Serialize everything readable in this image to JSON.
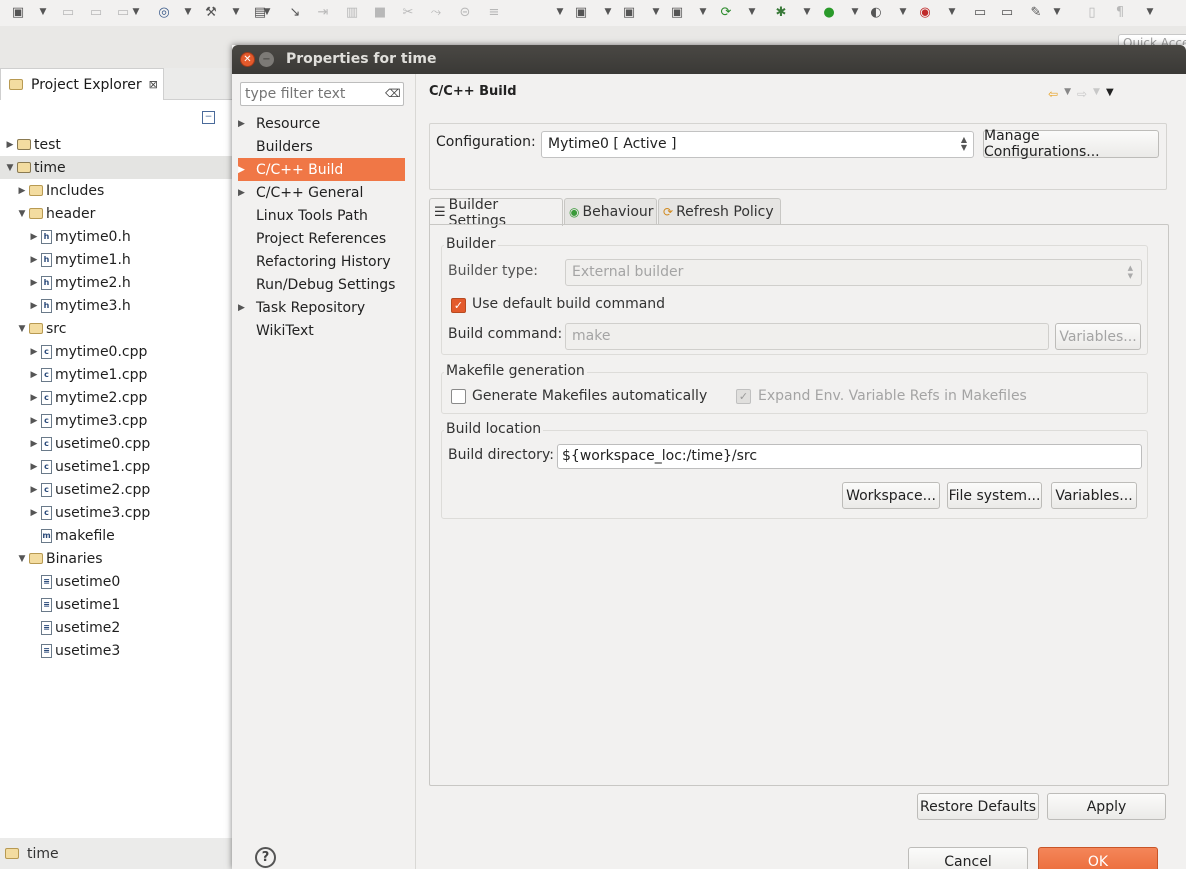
{
  "toolbar": {
    "icons": [
      "new-icon",
      "save-icon",
      "save-all-icon",
      "print-icon",
      "build-target-icon",
      "build-icon",
      "binary-icon",
      "pin-icon",
      "next-annotation-icon",
      "prev-annotation-icon",
      "stop-icon",
      "disconnect-icon",
      "step-icon",
      "skip-icon",
      "run-to-line-icon",
      "new-project-icon",
      "new-folder-icon",
      "new-class-icon",
      "refresh-icon",
      "debug-icon",
      "run-icon",
      "profile-icon",
      "external-tools-icon",
      "open-folder-icon",
      "open-type-icon",
      "search-icon",
      "page-icon",
      "paragraph-icon"
    ]
  },
  "quick_access": {
    "placeholder": "Quick Access"
  },
  "project_explorer": {
    "tab_title": "Project Explorer",
    "close_glyph": "⊠",
    "tree": [
      {
        "label": "test",
        "depth": 0,
        "arrow": "▶",
        "icon": "project-folder-icon",
        "kind": "proj"
      },
      {
        "label": "time",
        "depth": 0,
        "arrow": "▼",
        "icon": "project-folder-icon",
        "kind": "proj",
        "selected": true
      },
      {
        "label": "Includes",
        "depth": 1,
        "arrow": "▶",
        "icon": "includes-icon",
        "kind": "folder"
      },
      {
        "label": "header",
        "depth": 1,
        "arrow": "▼",
        "icon": "folder-icon",
        "kind": "folder"
      },
      {
        "label": "mytime0.h",
        "depth": 2,
        "arrow": "▶",
        "icon": "header-file-icon",
        "kind": "file",
        "glyph": "h"
      },
      {
        "label": "mytime1.h",
        "depth": 2,
        "arrow": "▶",
        "icon": "header-file-icon",
        "kind": "file",
        "glyph": "h"
      },
      {
        "label": "mytime2.h",
        "depth": 2,
        "arrow": "▶",
        "icon": "header-file-icon",
        "kind": "file",
        "glyph": "h"
      },
      {
        "label": "mytime3.h",
        "depth": 2,
        "arrow": "▶",
        "icon": "header-file-icon",
        "kind": "file",
        "glyph": "h"
      },
      {
        "label": "src",
        "depth": 1,
        "arrow": "▼",
        "icon": "source-folder-icon",
        "kind": "folder"
      },
      {
        "label": "mytime0.cpp",
        "depth": 2,
        "arrow": "▶",
        "icon": "cpp-file-icon",
        "kind": "file",
        "glyph": "c"
      },
      {
        "label": "mytime1.cpp",
        "depth": 2,
        "arrow": "▶",
        "icon": "cpp-file-icon",
        "kind": "file",
        "glyph": "c"
      },
      {
        "label": "mytime2.cpp",
        "depth": 2,
        "arrow": "▶",
        "icon": "cpp-file-icon",
        "kind": "file",
        "glyph": "c"
      },
      {
        "label": "mytime3.cpp",
        "depth": 2,
        "arrow": "▶",
        "icon": "cpp-file-icon",
        "kind": "file",
        "glyph": "c"
      },
      {
        "label": "usetime0.cpp",
        "depth": 2,
        "arrow": "▶",
        "icon": "cpp-file-icon",
        "kind": "file",
        "glyph": "c"
      },
      {
        "label": "usetime1.cpp",
        "depth": 2,
        "arrow": "▶",
        "icon": "cpp-file-icon",
        "kind": "file",
        "glyph": "c"
      },
      {
        "label": "usetime2.cpp",
        "depth": 2,
        "arrow": "▶",
        "icon": "cpp-file-icon",
        "kind": "file",
        "glyph": "c"
      },
      {
        "label": "usetime3.cpp",
        "depth": 2,
        "arrow": "▶",
        "icon": "cpp-file-icon",
        "kind": "file",
        "glyph": "c"
      },
      {
        "label": "makefile",
        "depth": 2,
        "arrow": "",
        "icon": "makefile-icon",
        "kind": "file",
        "glyph": "m"
      },
      {
        "label": "Binaries",
        "depth": 1,
        "arrow": "▼",
        "icon": "binaries-folder-icon",
        "kind": "folder"
      },
      {
        "label": "usetime0",
        "depth": 2,
        "arrow": "",
        "icon": "binary-file-icon",
        "kind": "file",
        "glyph": "≡"
      },
      {
        "label": "usetime1",
        "depth": 2,
        "arrow": "",
        "icon": "binary-file-icon",
        "kind": "file",
        "glyph": "≡"
      },
      {
        "label": "usetime2",
        "depth": 2,
        "arrow": "",
        "icon": "binary-file-icon",
        "kind": "file",
        "glyph": "≡"
      },
      {
        "label": "usetime3",
        "depth": 2,
        "arrow": "",
        "icon": "binary-file-icon",
        "kind": "file",
        "glyph": "≡"
      }
    ]
  },
  "status_bar": {
    "label": "time"
  },
  "dialog": {
    "title": "Properties for time",
    "filter": {
      "placeholder": "type filter text"
    },
    "nav": [
      {
        "label": "Resource",
        "arrow": "▶"
      },
      {
        "label": "Builders",
        "arrow": ""
      },
      {
        "label": "C/C++ Build",
        "arrow": "▶",
        "selected": true
      },
      {
        "label": "C/C++ General",
        "arrow": "▶"
      },
      {
        "label": "Linux Tools Path",
        "arrow": ""
      },
      {
        "label": "Project References",
        "arrow": ""
      },
      {
        "label": "Refactoring History",
        "arrow": ""
      },
      {
        "label": "Run/Debug Settings",
        "arrow": ""
      },
      {
        "label": "Task Repository",
        "arrow": "▶"
      },
      {
        "label": "WikiText",
        "arrow": ""
      }
    ],
    "page_title": "C/C++ Build",
    "configuration": {
      "label": "Configuration:",
      "value": "Mytime0  [ Active ]",
      "manage_button": "Manage Configurations..."
    },
    "tabs": [
      {
        "label": "Builder Settings",
        "icon": "builder-settings-icon",
        "active": true
      },
      {
        "label": "Behaviour",
        "icon": "behaviour-icon"
      },
      {
        "label": "Refresh Policy",
        "icon": "refresh-policy-icon"
      }
    ],
    "builder_group": {
      "title": "Builder",
      "type_label": "Builder type:",
      "type_value": "External builder",
      "use_default_label": "Use default build command",
      "use_default_checked": true,
      "command_label": "Build command:",
      "command_value": "make",
      "variables_button": "Variables..."
    },
    "makefile_group": {
      "title": "Makefile generation",
      "generate_label": "Generate Makefiles automatically",
      "generate_checked": false,
      "expand_label": "Expand Env. Variable Refs in Makefiles",
      "expand_checked": true
    },
    "location_group": {
      "title": "Build location",
      "dir_label": "Build directory:",
      "dir_value": "${workspace_loc:/time}/src",
      "workspace_button": "Workspace...",
      "filesystem_button": "File system...",
      "variables_button": "Variables..."
    },
    "restore_button": "Restore Defaults",
    "apply_button": "Apply",
    "cancel_button": "Cancel",
    "ok_button": "OK",
    "help_glyph": "?"
  }
}
